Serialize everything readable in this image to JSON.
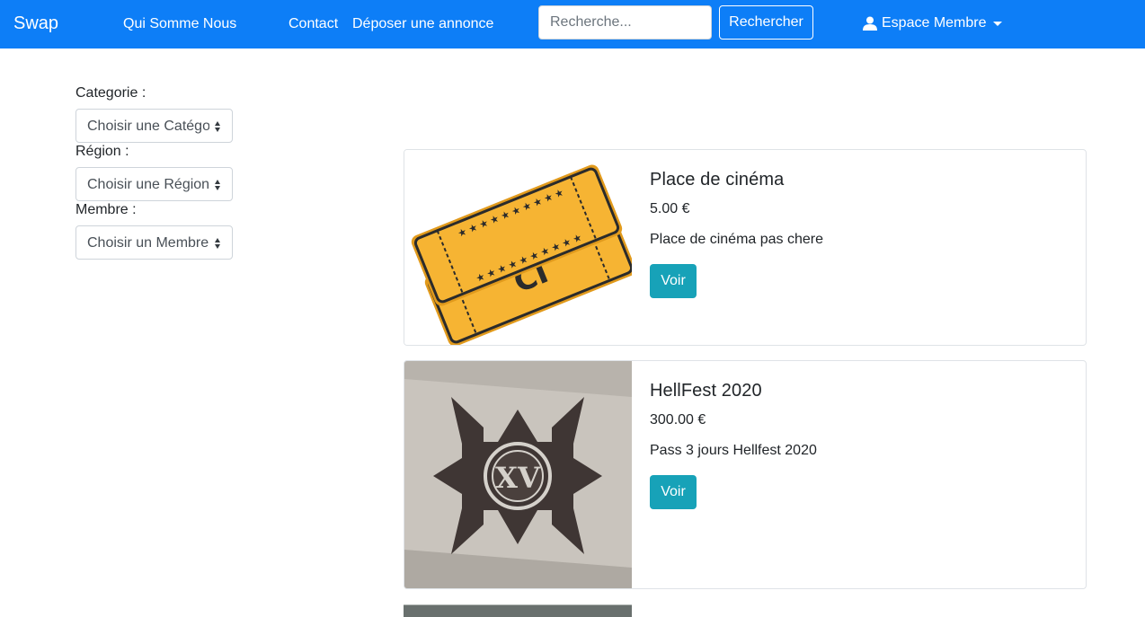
{
  "navbar": {
    "brand": "Swap",
    "links": [
      "Qui Somme Nous",
      "Contact",
      "Déposer une annonce"
    ],
    "search": {
      "placeholder": "Recherche...",
      "value": ""
    },
    "search_button": "Rechercher",
    "member_menu": "Espace Membre"
  },
  "filters": [
    {
      "label": "Categorie :",
      "selected": "Choisir une Catégorie"
    },
    {
      "label": "Région :",
      "selected": "Choisir une Région"
    },
    {
      "label": "Membre :",
      "selected": "Choisir un Membre"
    }
  ],
  "listings": [
    {
      "title": "Place de cinéma",
      "price": "5.00 €",
      "description": "Place de cinéma pas chere",
      "button": "Voir",
      "image": "cinema-tickets-image"
    },
    {
      "title": "HellFest 2020",
      "price": "300.00 €",
      "description": "Pass 3 jours Hellfest 2020",
      "button": "Voir",
      "image": "hellfest-cross-image"
    }
  ],
  "colors": {
    "navbar": "#0d7ef7",
    "voir_button": "#17a2b8",
    "ticket": "#f6b433"
  }
}
